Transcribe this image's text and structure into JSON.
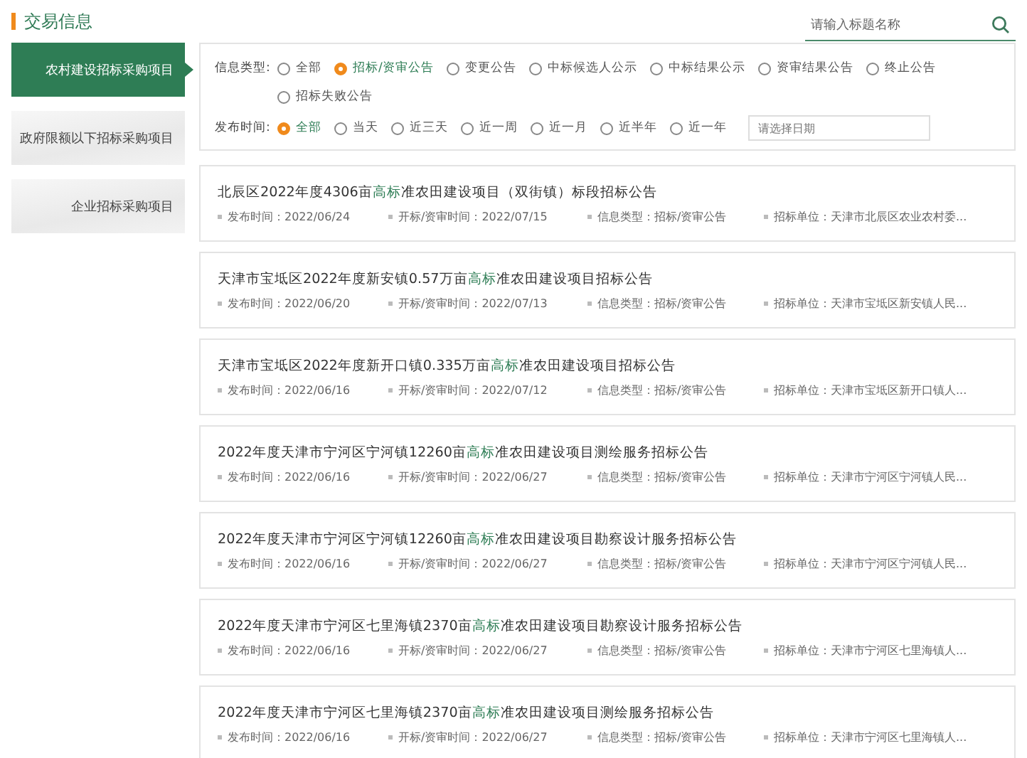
{
  "section_title": "交易信息",
  "search": {
    "placeholder": "请输入标题名称"
  },
  "sidebar": {
    "items": [
      {
        "label": "农村建设招标采购项目",
        "selected": true
      },
      {
        "label": "政府限额以下招标采购项目",
        "selected": false
      },
      {
        "label": "企业招标采购项目",
        "selected": false
      }
    ]
  },
  "filters": [
    {
      "label": "信息类型:",
      "options": [
        {
          "label": "全部",
          "selected": false
        },
        {
          "label": "招标/资审公告",
          "selected": true
        },
        {
          "label": "变更公告",
          "selected": false
        },
        {
          "label": "中标候选人公示",
          "selected": false
        },
        {
          "label": "中标结果公示",
          "selected": false
        },
        {
          "label": "资审结果公告",
          "selected": false
        },
        {
          "label": "终止公告",
          "selected": false
        },
        {
          "label": "招标失败公告",
          "selected": false
        }
      ]
    },
    {
      "label": "发布时间:",
      "options": [
        {
          "label": "全部",
          "selected": true
        },
        {
          "label": "当天",
          "selected": false
        },
        {
          "label": "近三天",
          "selected": false
        },
        {
          "label": "近一周",
          "selected": false
        },
        {
          "label": "近一月",
          "selected": false
        },
        {
          "label": "近半年",
          "selected": false
        },
        {
          "label": "近一年",
          "selected": false
        }
      ],
      "date_field": {
        "placeholder": "请选择日期"
      }
    }
  ],
  "notices": [
    {
      "title_start": "北辰区2022年度4306亩",
      "title_highlight": "高标",
      "title_end": "准农田建设项目（双街镇）标段招标公告",
      "meta": [
        "发布时间：2022/06/24",
        "开标/资审时间：2022/07/15",
        "信息类型：招标/资审公告",
        "招标单位：天津市北辰区农业农村委..."
      ]
    },
    {
      "title_start": "天津市宝坻区2022年度新安镇0.57万亩",
      "title_highlight": "高标",
      "title_end": "准农田建设项目招标公告",
      "meta": [
        "发布时间：2022/06/20",
        "开标/资审时间：2022/07/13",
        "信息类型：招标/资审公告",
        "招标单位：天津市宝坻区新安镇人民..."
      ]
    },
    {
      "title_start": "天津市宝坻区2022年度新开口镇0.335万亩",
      "title_highlight": "高标",
      "title_end": "准农田建设项目招标公告",
      "meta": [
        "发布时间：2022/06/16",
        "开标/资审时间：2022/07/12",
        "信息类型：招标/资审公告",
        "招标单位：天津市宝坻区新开口镇人..."
      ]
    },
    {
      "title_start": "2022年度天津市宁河区宁河镇12260亩",
      "title_highlight": "高标",
      "title_end": "准农田建设项目测绘服务招标公告",
      "meta": [
        "发布时间：2022/06/16",
        "开标/资审时间：2022/06/27",
        "信息类型：招标/资审公告",
        "招标单位：天津市宁河区宁河镇人民..."
      ]
    },
    {
      "title_start": "2022年度天津市宁河区宁河镇12260亩",
      "title_highlight": "高标",
      "title_end": "准农田建设项目勘察设计服务招标公告",
      "meta": [
        "发布时间：2022/06/16",
        "开标/资审时间：2022/06/27",
        "信息类型：招标/资审公告",
        "招标单位：天津市宁河区宁河镇人民..."
      ]
    },
    {
      "title_start": "2022年度天津市宁河区七里海镇2370亩",
      "title_highlight": "高标",
      "title_end": "准农田建设项目勘察设计服务招标公告",
      "meta": [
        "发布时间：2022/06/16",
        "开标/资审时间：2022/06/27",
        "信息类型：招标/资审公告",
        "招标单位：天津市宁河区七里海镇人..."
      ]
    },
    {
      "title_start": "2022年度天津市宁河区七里海镇2370亩",
      "title_highlight": "高标",
      "title_end": "准农田建设项目测绘服务招标公告",
      "meta": [
        "发布时间：2022/06/16",
        "开标/资审时间：2022/06/27",
        "信息类型：招标/资审公告",
        "招标单位：天津市宁河区七里海镇人..."
      ]
    }
  ]
}
